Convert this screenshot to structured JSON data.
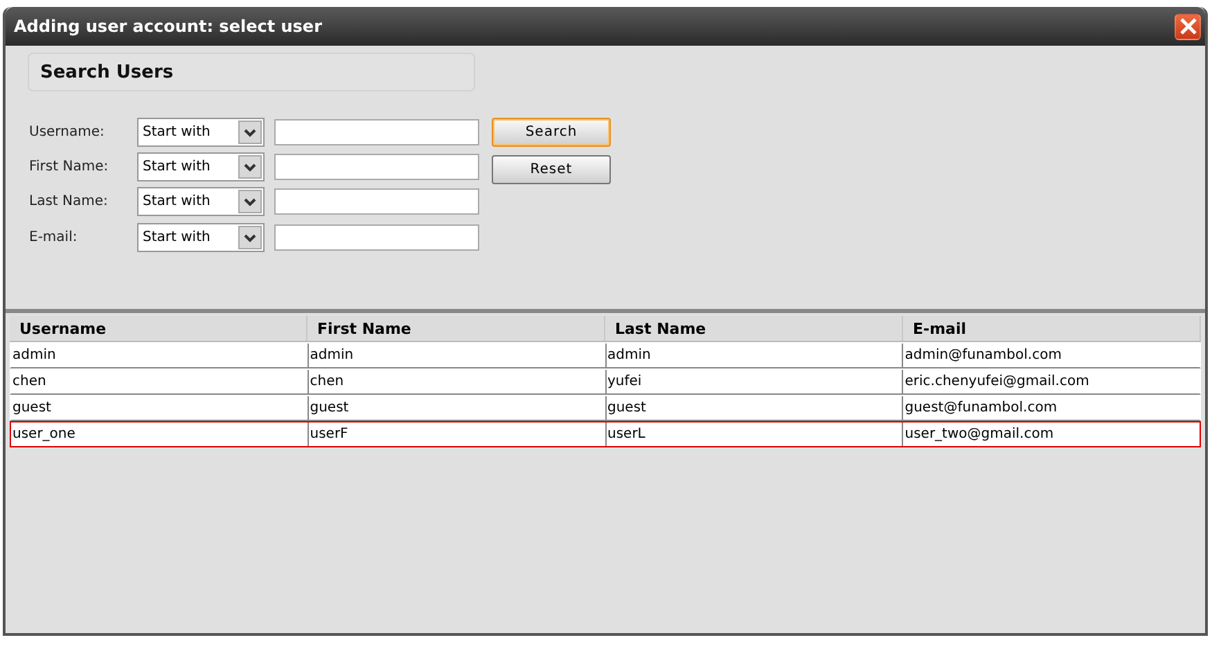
{
  "window": {
    "title": "Adding user account: select user"
  },
  "search_panel": {
    "title": "Search Users"
  },
  "filters": [
    {
      "label": "Username:",
      "operator": "Start with"
    },
    {
      "label": "First Name:",
      "operator": "Start with"
    },
    {
      "label": "Last Name:",
      "operator": "Start with"
    },
    {
      "label": "E-mail:",
      "operator": "Start with"
    }
  ],
  "buttons": [
    {
      "label": "Search",
      "focused": true
    },
    {
      "label": "Reset",
      "focused": false
    }
  ],
  "table": {
    "columns": [
      "Username",
      "First Name",
      "Last Name",
      "E-mail"
    ],
    "rows": [
      {
        "cells": [
          "admin",
          "admin",
          "admin",
          "admin@funambol.com"
        ],
        "selected": false
      },
      {
        "cells": [
          "chen",
          "chen",
          "yufei",
          "eric.chenyufei@gmail.com"
        ],
        "selected": false
      },
      {
        "cells": [
          "guest",
          "guest",
          "guest",
          "guest@funambol.com"
        ],
        "selected": false
      },
      {
        "cells": [
          "user_one",
          "userF",
          "userL",
          "user_two@gmail.com"
        ],
        "selected": true
      }
    ]
  }
}
